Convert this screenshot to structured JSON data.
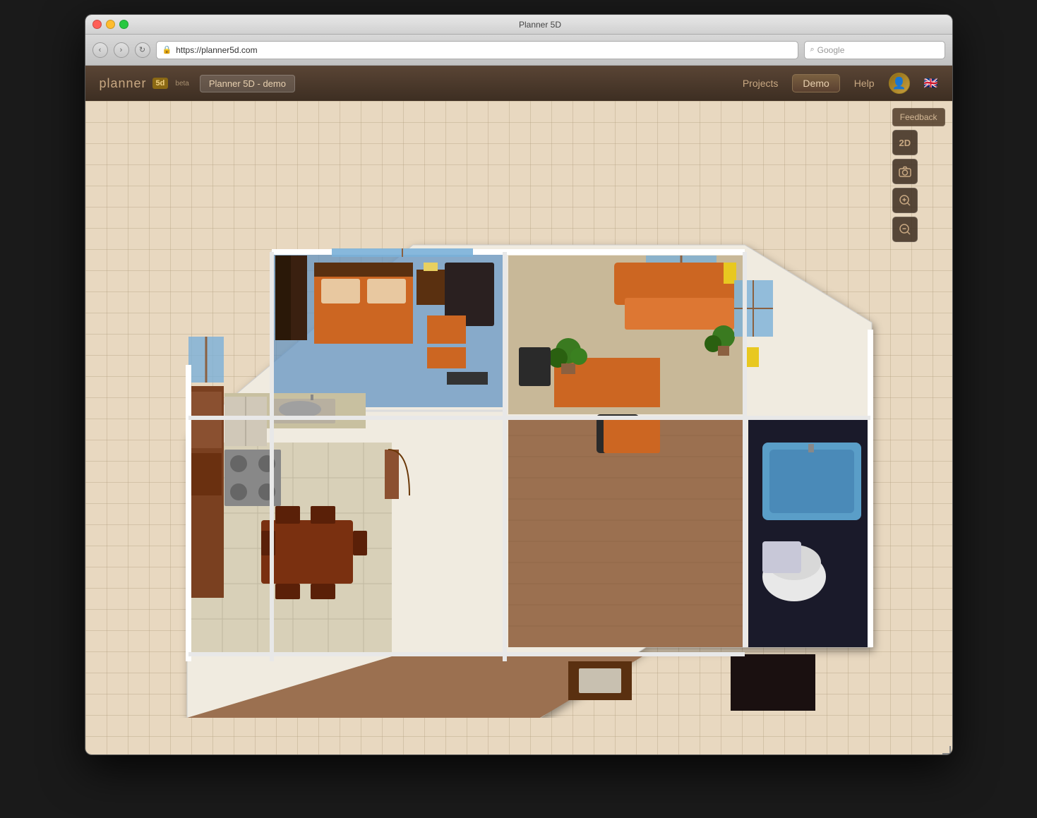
{
  "window": {
    "title": "Planner 5D",
    "controls": {
      "close": "close",
      "minimize": "minimize",
      "maximize": "maximize"
    }
  },
  "browser": {
    "url": "https://planner5d.com",
    "search_placeholder": "Google",
    "back_label": "‹",
    "forward_label": "›"
  },
  "header": {
    "logo_text": "planner",
    "logo_box": "5d",
    "beta_label": "beta",
    "project_name": "Planner 5D - demo",
    "nav_projects": "Projects",
    "nav_demo": "Demo",
    "nav_help": "Help"
  },
  "toolbar": {
    "feedback_label": "Feedback",
    "view_2d": "2D",
    "camera_icon": "📷",
    "zoom_in_icon": "🔍",
    "zoom_out_icon": "🔍"
  },
  "floor_plan": {
    "description": "3D isometric view of apartment floor plan with multiple rooms",
    "rooms": [
      {
        "name": "bedroom",
        "color": "#4a7ab5"
      },
      {
        "name": "living-room",
        "color": "#8B6914"
      },
      {
        "name": "kitchen",
        "color": "#c8c0a8"
      },
      {
        "name": "bathroom",
        "color": "#4a7ab5"
      },
      {
        "name": "office",
        "color": "#8B6040"
      }
    ]
  },
  "colors": {
    "header_bg": "#3d2e22",
    "grid_bg": "#e8d8c0",
    "toolbar_bg": "rgba(60,45,30,0.85)",
    "feedback_bg": "rgba(80,60,40,0.85)",
    "accent": "#c8a882",
    "wall_color": "#f0ebe0",
    "floor_wood": "#8B6040",
    "floor_tile": "#d8d0b8",
    "furniture_orange": "#cc6622",
    "furniture_dark": "#2a1a0a"
  }
}
